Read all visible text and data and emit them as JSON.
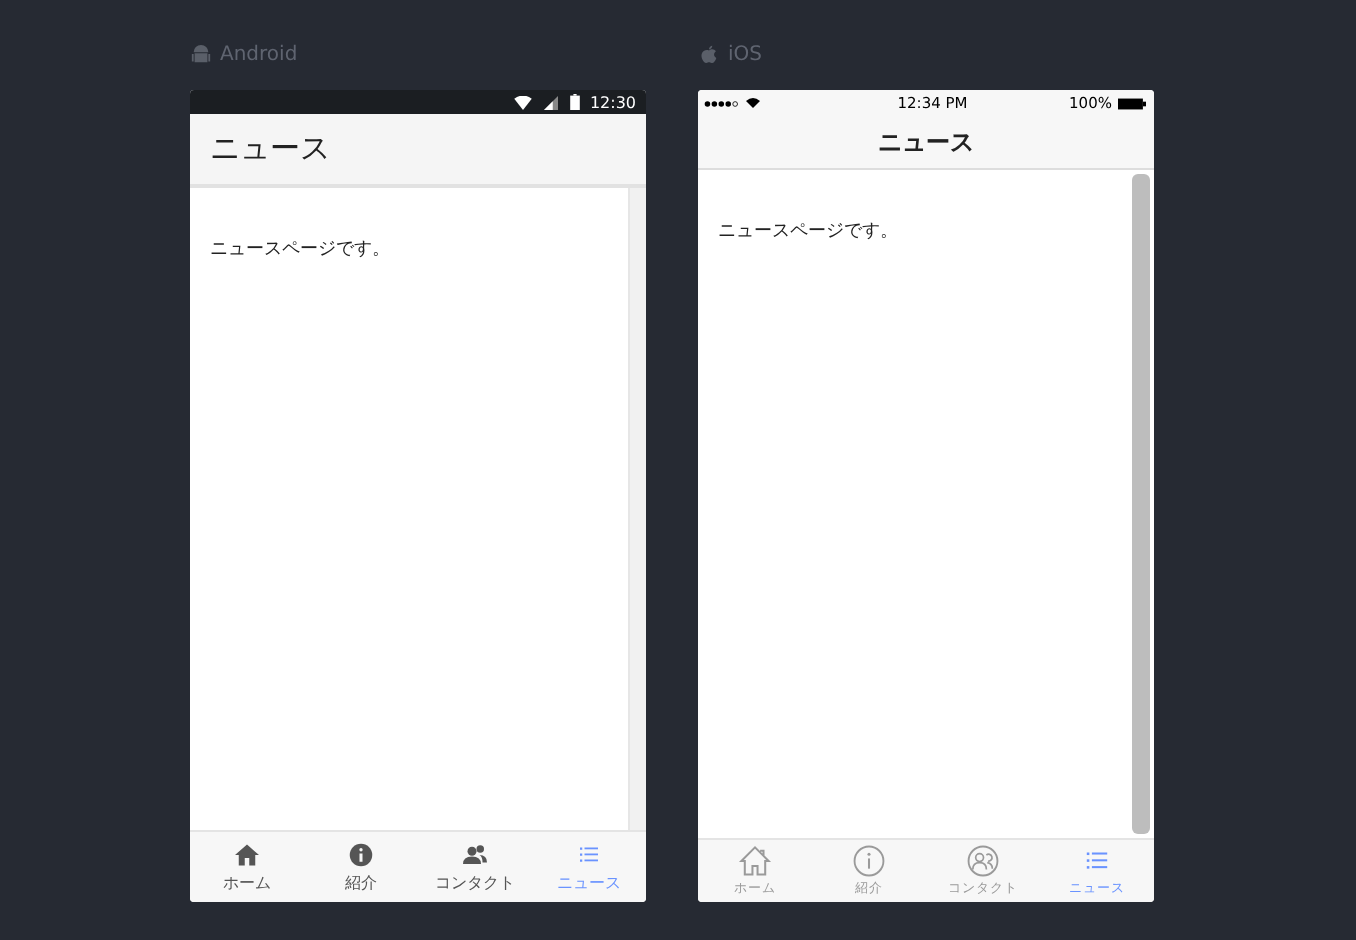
{
  "devices": [
    {
      "kind": "android",
      "label": "Android",
      "status_time": "12:30",
      "title": "ニュース",
      "body": "ニュースページです。",
      "tabs": [
        {
          "label": "ホーム",
          "selected": false
        },
        {
          "label": "紹介",
          "selected": false
        },
        {
          "label": "コンタクト",
          "selected": false
        },
        {
          "label": "ニュース",
          "selected": true
        }
      ]
    },
    {
      "kind": "ios",
      "label": "iOS",
      "status_time": "12:34 PM",
      "battery": "100%",
      "title": "ニュース",
      "body": "ニュースページです。",
      "tabs": [
        {
          "label": "ホーム",
          "selected": false
        },
        {
          "label": "紹介",
          "selected": false
        },
        {
          "label": "コンタクト",
          "selected": false
        },
        {
          "label": "ニュース",
          "selected": true
        }
      ]
    }
  ]
}
